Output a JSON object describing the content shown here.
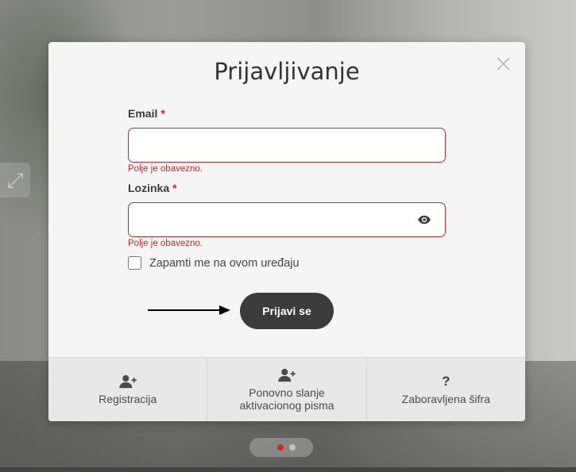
{
  "modal": {
    "title": "Prijavljivanje",
    "close_icon": "close-icon"
  },
  "form": {
    "email": {
      "label": "Email",
      "required_mark": "*",
      "value": "",
      "error": "Polje je obavezno."
    },
    "password": {
      "label": "Lozinka",
      "required_mark": "*",
      "value": "",
      "error": "Polje je obavezno.",
      "toggle_icon": "eye-icon"
    },
    "remember": {
      "label": "Zapamti me na ovom uređaju",
      "checked": false
    },
    "submit_label": "Prijavi se"
  },
  "footer": {
    "items": [
      {
        "label": "Registracija",
        "icon": "user-plus-icon"
      },
      {
        "label": "Ponovno slanje aktivacionog pisma",
        "icon": "user-plus-icon"
      },
      {
        "label": "Zaboravljena šifra",
        "icon": "question-icon"
      }
    ]
  },
  "colors": {
    "error": "#c0292b",
    "button": "#3b3b3b",
    "modal_bg": "#f5f5f5",
    "footer_bg": "#e8e8e8"
  }
}
